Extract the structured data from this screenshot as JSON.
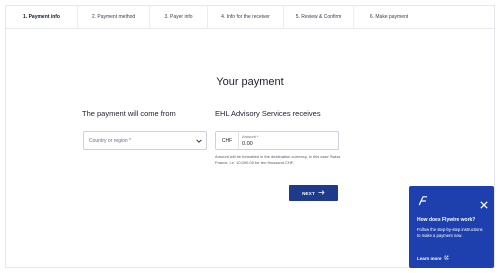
{
  "stepper": {
    "steps": [
      {
        "label": "1. Payment info",
        "active": true
      },
      {
        "label": "2. Payment method",
        "active": false
      },
      {
        "label": "3. Payer info",
        "active": false
      },
      {
        "label": "4. Info for the receiver",
        "active": false
      },
      {
        "label": "5. Review & Confirm",
        "active": false
      },
      {
        "label": "6. Make payment",
        "active": false
      }
    ]
  },
  "main": {
    "title": "Your payment",
    "left_title": "The payment will come from",
    "right_title": "EHL Advisory Services receives",
    "country_placeholder": "Country or region *",
    "currency": "CHF",
    "amount_label": "Amount *",
    "amount_value": "0.00",
    "amount_note": "Amount will be formatted in the destination currency, in this case Swiss Francs. I.e. 10,000.00 for ten thousand CHF.",
    "next_label": "NEXT"
  },
  "widget": {
    "title": "How does Flywire work?",
    "body": "Follow the step-by-step instructions to make a payment now.",
    "link": "Learn more",
    "colors": {
      "background": "#1e40af",
      "text": "#ffffff"
    }
  },
  "colors": {
    "accent": "#1e3a8a"
  }
}
